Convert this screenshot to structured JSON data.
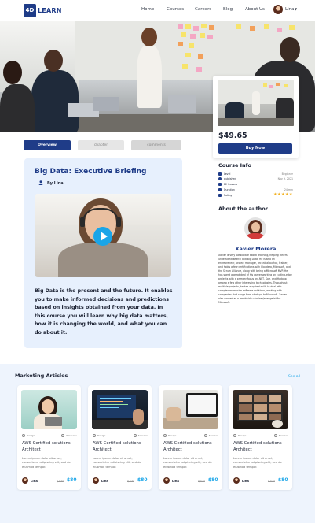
{
  "nav": {
    "logo_mark": "4D",
    "logo_text": "LEARN",
    "links": [
      "Home",
      "Courses",
      "Careers",
      "Blog",
      "About Us"
    ],
    "user_name": "Lina"
  },
  "side": {
    "price": "$49.65",
    "buy_label": "Buy Now"
  },
  "tabs": [
    "Overview",
    "chapter",
    "comments"
  ],
  "course": {
    "title": "Big Data: Executive Briefing",
    "by": "By Lina",
    "description": "Big Data is the present and the future. It enables you to make informed decisions and predictions based on insights obtained from your data. In this course you will learn why big data matters, how it is changing the world, and what you can do about it."
  },
  "course_info": {
    "heading": "Course Info",
    "rows": [
      {
        "label": "Level",
        "value": "Beginner"
      },
      {
        "label": "published",
        "value": "Nov 9, 2021"
      },
      {
        "label": "22 lessons",
        "value": ""
      },
      {
        "label": "Duration",
        "value": "24 min"
      },
      {
        "label": "Rating",
        "value": ""
      }
    ],
    "rating_stars": "★★★★★"
  },
  "author": {
    "heading": "About the author",
    "name": "Xavier Morera",
    "bio": "Xavier is very passionate about teaching, helping others understand search and Big Data. He is also an entrepreneur, project manager, technical author, trainer, and holds a few certifications with Cloudera, Microsoft, and the Scrum Alliance, along with being a Microsoft MVP. He has spent a great deal of his career working on cutting-edge projects with a primary focus on .NET, Solr, and Hadoop among a few other interesting technologies. Throughout multiple projects, he has acquired skills to deal with complex enterprise software solutions, working with companies that range from startups to Microsoft. Xavier also worked as a worldwide v-trainer/evangelist for Microsoft."
  },
  "articles": {
    "heading": "Marketing Articles",
    "see_all": "See all",
    "cards": [
      {
        "cat": "Design",
        "lessons": "3 lessons",
        "title": "AWS Certified solutions Architect",
        "desc": "Lorem ipsum dolor sit amet, consectetur adipiscing elit, sed do eiusmod tempor.",
        "author": "Lina",
        "old": "$100",
        "new": "$80"
      },
      {
        "cat": "Design",
        "lessons": "3 lesson",
        "title": "AWS Certified solutions Architect",
        "desc": "Lorem ipsum dolor sit amet, consectetur adipiscing elit, sed do eiusmod tempor.",
        "author": "Lina",
        "old": "$100",
        "new": "$80"
      },
      {
        "cat": "Design",
        "lessons": "3 lesson",
        "title": "AWS Certified solutions Architect",
        "desc": "Lorem ipsum dolor sit amet, consectetur adipiscing elit, sed do eiusmod tempor.",
        "author": "Lina",
        "old": "$100",
        "new": "$80"
      },
      {
        "cat": "Design",
        "lessons": "3 lesson",
        "title": "AWS Certified solutions Architect",
        "desc": "Lorem ipsum dolor sit amet, consectetur adipiscing elit, sed do eiusmod tempor.",
        "author": "Lina",
        "old": "$100",
        "new": "$80"
      }
    ]
  },
  "colors": {
    "brand": "#1f3c88",
    "accent": "#1aa5e8",
    "panel": "#e7f0fd",
    "stars": "#f2b01e"
  }
}
